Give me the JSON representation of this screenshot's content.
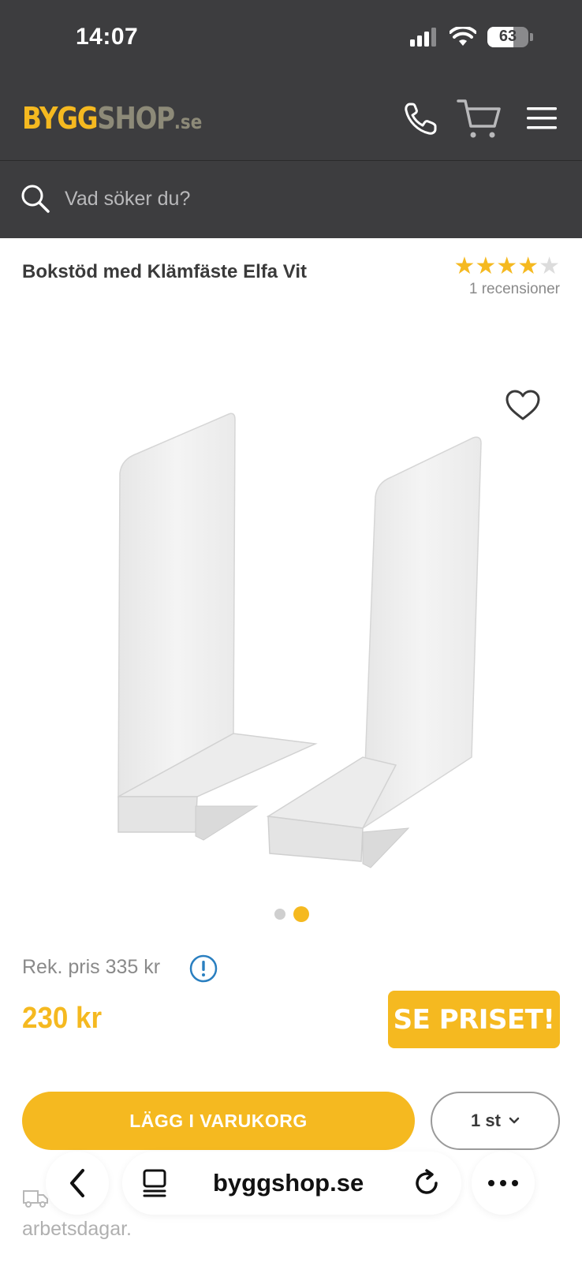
{
  "status_bar": {
    "time": "14:07",
    "battery": "63"
  },
  "header": {
    "logo": {
      "part1": "BYGG",
      "part2": "SHOP",
      "part3": ".se"
    },
    "icons": [
      "phone-icon",
      "cart-icon",
      "menu-icon"
    ]
  },
  "search": {
    "placeholder": "Vad söker du?"
  },
  "product": {
    "title": "Bokstöd med Klämfäste Elfa Vit",
    "rating": {
      "stars": 4,
      "max": 5,
      "reviews": "1 recensioner"
    },
    "gallery": {
      "current": 2,
      "total": 2
    },
    "rek_price": "Rek. pris 335 kr",
    "price": "230 kr",
    "see_price_label": "SE PRISET!",
    "add_to_cart_label": "LÄGG I VARUKORG",
    "quantity": "1 st",
    "delivery_text": "arbetsdagar."
  },
  "browser": {
    "url": "byggshop.se"
  },
  "colors": {
    "accent": "#f5b920",
    "header_bg": "#3d3d3f",
    "info_blue": "#2a7fc0"
  }
}
